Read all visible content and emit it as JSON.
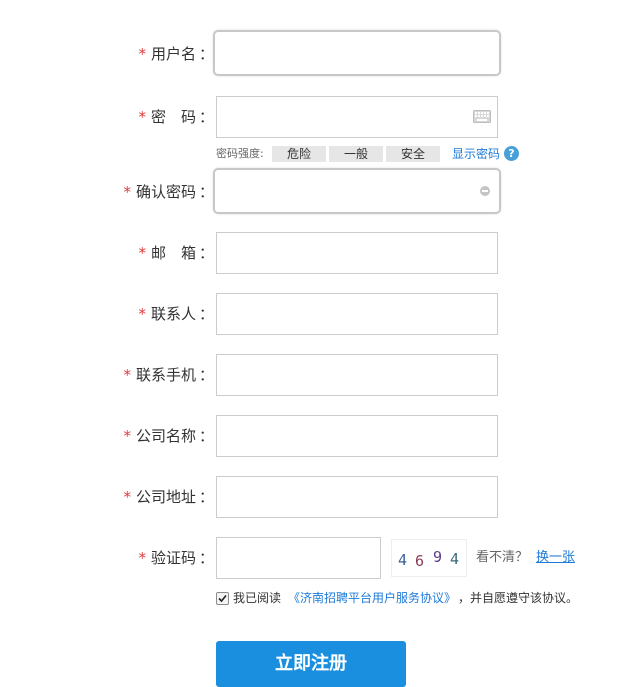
{
  "form": {
    "fields": {
      "username": {
        "label": "用户名"
      },
      "password": {
        "label": "密　码"
      },
      "confirm": {
        "label": "确认密码"
      },
      "email": {
        "label": "邮　箱"
      },
      "contact": {
        "label": "联系人"
      },
      "mobile": {
        "label": "联系手机"
      },
      "company": {
        "label": "公司名称"
      },
      "address": {
        "label": "公司地址"
      },
      "captcha": {
        "label": "验证码"
      }
    },
    "required_mark": "*",
    "colon": "："
  },
  "strength": {
    "label": "密码强度:",
    "levels": [
      "危险",
      "一般",
      "安全"
    ],
    "show_password": "显示密码",
    "help": "?"
  },
  "captcha": {
    "digits": [
      "4",
      "6",
      "9",
      "4"
    ],
    "digit_colors": [
      "#3a5f9a",
      "#8a3a5a",
      "#5a3a8a",
      "#3a6a7a"
    ],
    "hint": "看不清？",
    "refresh": "换一张"
  },
  "agreement": {
    "checked": true,
    "prefix": "我已阅读",
    "link": "《济南招聘平台用户服务协议》",
    "suffix": "，并自愿遵守该协议。"
  },
  "submit": {
    "label": "立即注册"
  },
  "colors": {
    "required": "#e4393c",
    "link": "#1d7ad9",
    "button": "#1a8fe0"
  }
}
